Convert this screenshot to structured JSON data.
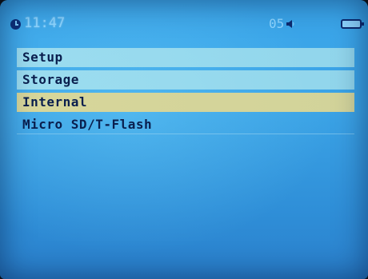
{
  "status": {
    "time": "11:47",
    "volume": "05",
    "icons": [
      "clock-icon",
      "speaker-icon",
      "battery-icon"
    ]
  },
  "menu": {
    "title": "Setup",
    "subtitle": "Storage",
    "items": [
      {
        "label": "Internal",
        "selected": true
      },
      {
        "label": "Micro SD/T-Flash",
        "selected": false
      }
    ]
  },
  "colors": {
    "background": "#3aa6ea",
    "selected_highlight": "#d7d69a",
    "header_bar": "#aae4f0",
    "text": "#0a1f4e",
    "status_text": "#8fd6ff"
  }
}
